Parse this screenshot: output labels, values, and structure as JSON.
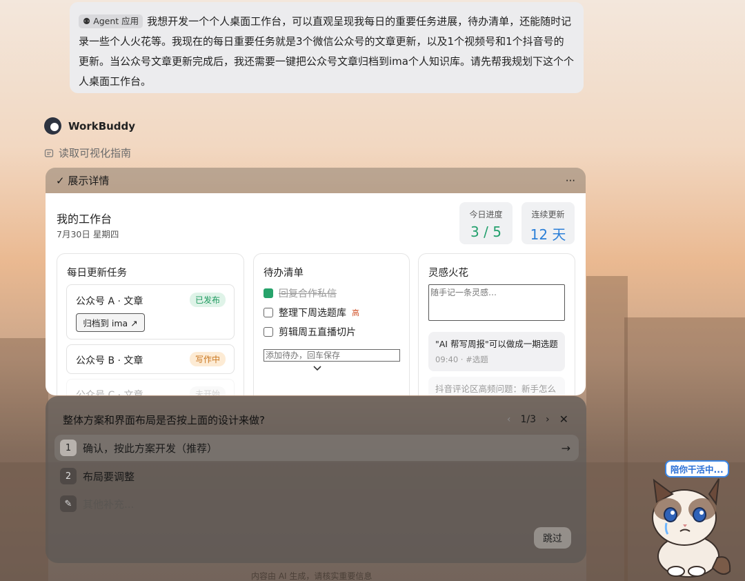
{
  "user_message": {
    "tag": "Agent 应用",
    "text": "我想开发一个个人桌面工作台，可以直观呈现我每日的重要任务进展，待办清单，还能随时记录一些个人火花等。我现在的每日重要任务就是3个微信公众号的文章更新，以及1个视频号和1个抖音号的更新。当公众号文章更新完成后，我还需要一键把公众号文章归档到ima个人知识库。请先帮我规划下这个个人桌面工作台。"
  },
  "assistant": {
    "name": "WorkBuddy",
    "step": "读取可视化指南"
  },
  "details_panel": {
    "toggle_label": "展示详情",
    "more_label": "···",
    "workspace": {
      "title": "我的工作台",
      "date": "7月30日 星期四",
      "stats": [
        {
          "label": "今日进度",
          "value": "3 / 5",
          "color": "#23a06d"
        },
        {
          "label": "连续更新",
          "value": "12 天",
          "color": "#2b7fd8"
        }
      ],
      "tasks": {
        "title": "每日更新任务",
        "items": [
          {
            "name": "公众号 A · 文章",
            "status": "已发布",
            "action": "归档到 ima ↗"
          },
          {
            "name": "公众号 B · 文章",
            "status": "写作中"
          },
          {
            "name": "公众号 C · 文章",
            "status": "未开始"
          }
        ]
      },
      "todos": {
        "title": "待办清单",
        "items": [
          {
            "text": "回复合作私信",
            "done": true,
            "priority": ""
          },
          {
            "text": "整理下周选题库",
            "done": false,
            "priority": "高"
          },
          {
            "text": "剪辑周五直播切片",
            "done": false,
            "priority": ""
          }
        ],
        "input_placeholder": "添加待办，回车保存"
      },
      "ideas": {
        "title": "灵感火花",
        "input_placeholder": "随手记一条灵感…",
        "items": [
          {
            "text": "\"AI 帮写周报\"可以做成一期选题",
            "meta": "09:40 · #选题"
          },
          {
            "text": "抖音评论区高频问题：新手怎么",
            "meta": ""
          }
        ]
      }
    }
  },
  "question": {
    "title": "整体方案和界面布局是否按上面的设计来做?",
    "pager": "1/3",
    "options": [
      {
        "num": "1",
        "label": "确认，按此方案开发（推荐）"
      },
      {
        "num": "2",
        "label": "布局要调整"
      }
    ],
    "other_placeholder": "其他补充...",
    "skip_label": "跳过"
  },
  "disclaimer": "内容由 AI 生成，请核实重要信息",
  "mascot": {
    "badge": "陪你干活中..."
  }
}
